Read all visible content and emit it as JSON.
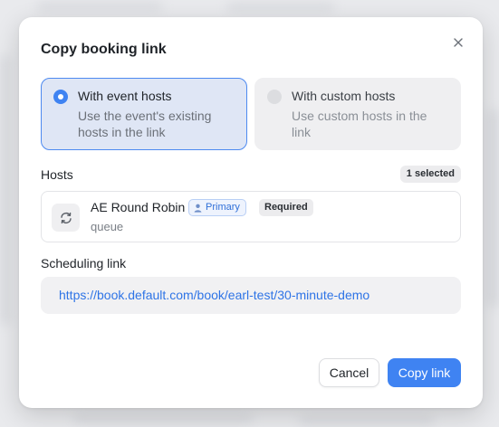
{
  "modal": {
    "title": "Copy booking link",
    "close_icon": "close-icon"
  },
  "options": [
    {
      "title": "With event hosts",
      "description": "Use the event's existing hosts in the link",
      "selected": true
    },
    {
      "title": "With custom hosts",
      "description": "Use custom hosts in the link",
      "selected": false
    }
  ],
  "hosts": {
    "label": "Hosts",
    "selected_count": "1 selected",
    "items": [
      {
        "name": "AE Round Robin",
        "subtitle": "queue",
        "icon": "refresh-cycle-icon",
        "badges": {
          "primary": "Primary",
          "primary_icon": "user-icon",
          "required": "Required"
        }
      }
    ]
  },
  "scheduling": {
    "label": "Scheduling link",
    "url": "https://book.default.com/book/earl-test/30-minute-demo"
  },
  "actions": {
    "cancel": "Cancel",
    "copy": "Copy link"
  },
  "colors": {
    "accent": "#3f83f2",
    "selected_option_bg": "#dfe6f5",
    "link": "#2e74e6"
  }
}
